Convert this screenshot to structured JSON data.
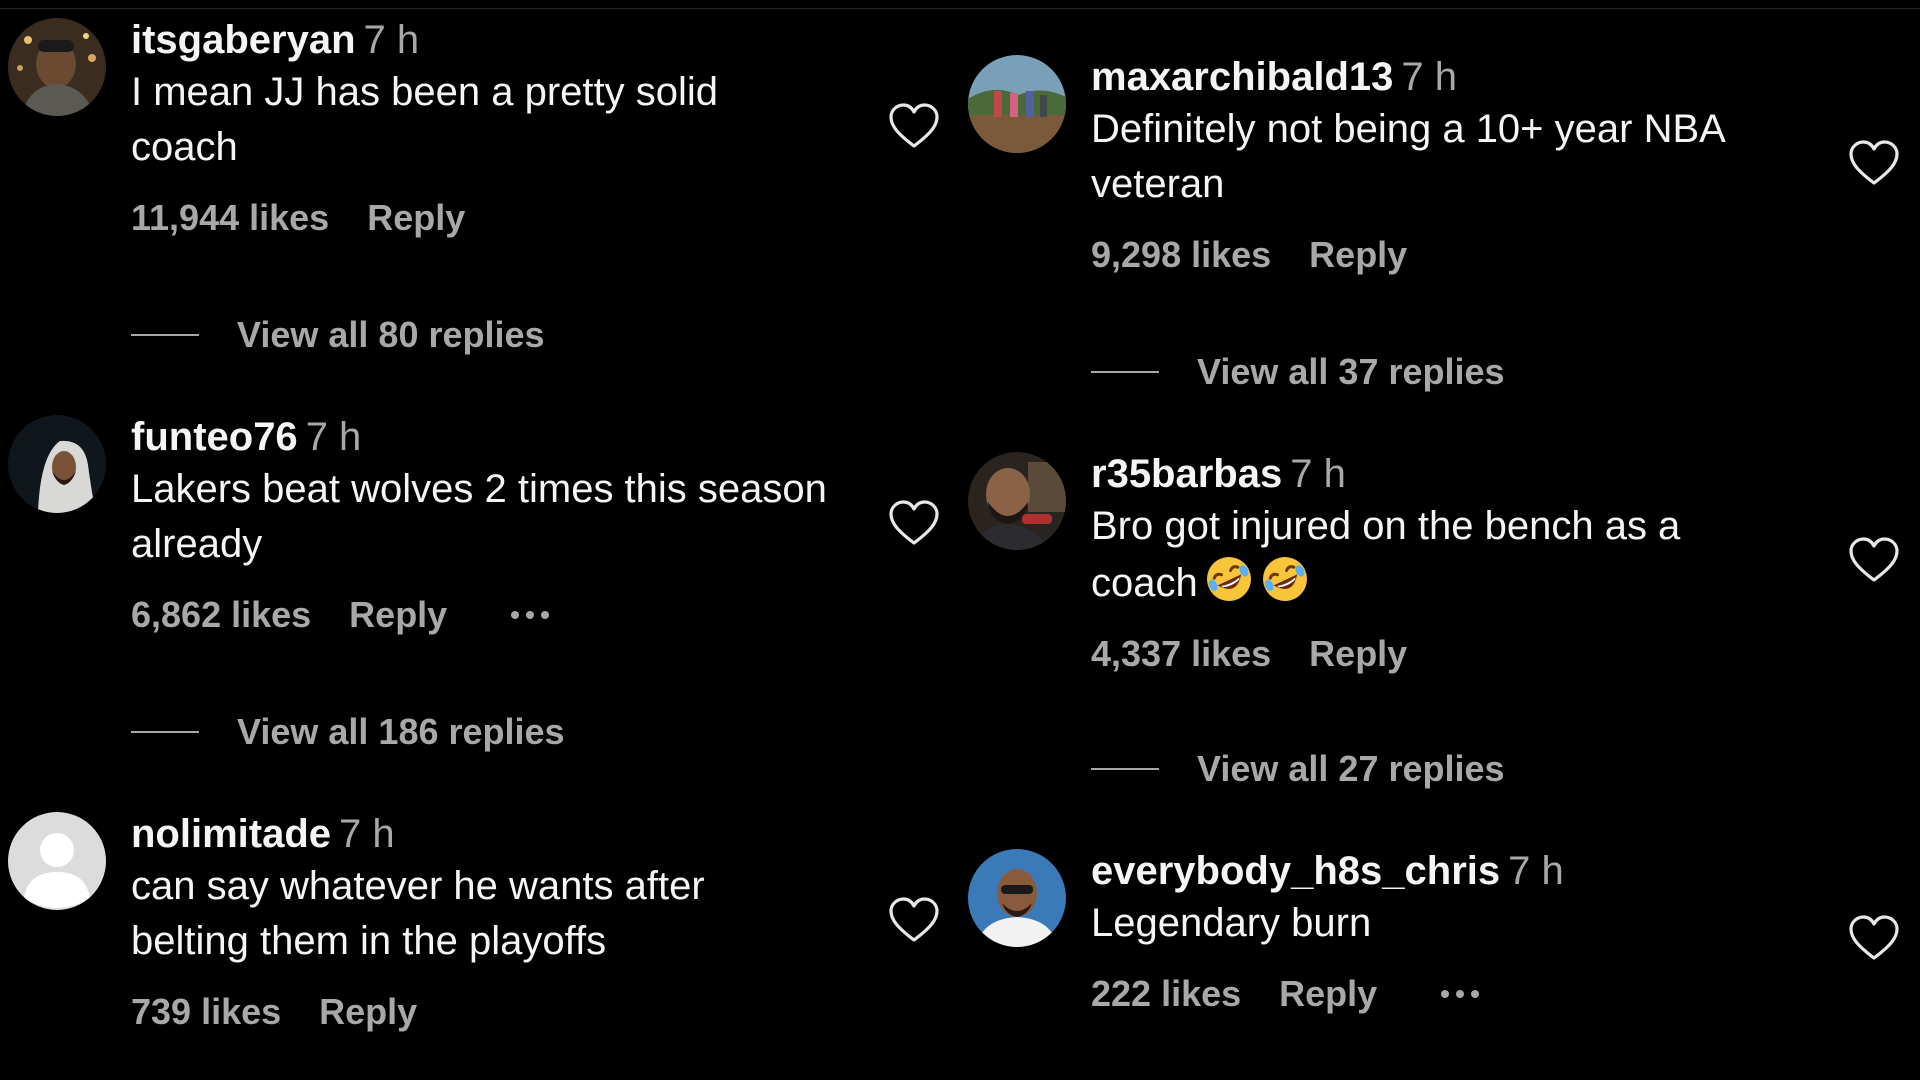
{
  "comments": {
    "left": [
      {
        "username": "itsgaberyan",
        "time": "7 h",
        "text": "I mean JJ has been a pretty solid coach",
        "likes": "11,944 likes",
        "reply": "Reply",
        "view_replies": "View all 80 replies",
        "has_more": false
      },
      {
        "username": "funteo76",
        "time": "7 h",
        "text": "Lakers beat wolves 2 times this season already",
        "likes": "6,862 likes",
        "reply": "Reply",
        "view_replies": "View all 186 replies",
        "has_more": true
      },
      {
        "username": "nolimitade",
        "time": "7 h",
        "text": "can say whatever he wants after belting them in the playoffs",
        "likes": "739 likes",
        "reply": "Reply",
        "view_replies": "",
        "has_more": false
      }
    ],
    "right": [
      {
        "username": "maxarchibald13",
        "time": "7 h",
        "text": "Definitely not being a 10+ year NBA veteran",
        "likes": "9,298 likes",
        "reply": "Reply",
        "view_replies": "View all 37 replies",
        "has_more": false
      },
      {
        "username": "r35barbas",
        "time": "7 h",
        "text": "Bro got injured on the bench as a coach",
        "emoji": [
          "rolling-on-floor-laughing-emoji",
          "rolling-on-floor-laughing-emoji"
        ],
        "likes": "4,337 likes",
        "reply": "Reply",
        "view_replies": "View all 27 replies",
        "has_more": false
      },
      {
        "username": "everybody_h8s_chris",
        "time": "7 h",
        "text": "Legendary burn",
        "likes": "222 likes",
        "reply": "Reply",
        "view_replies": "",
        "has_more": true
      }
    ]
  },
  "icons": {
    "like": "heart-outline-icon",
    "more": "more-horizontal-icon"
  },
  "colors": {
    "background": "#000000",
    "primary_text": "#f5f5f5",
    "secondary_text": "#a8a8a8"
  }
}
